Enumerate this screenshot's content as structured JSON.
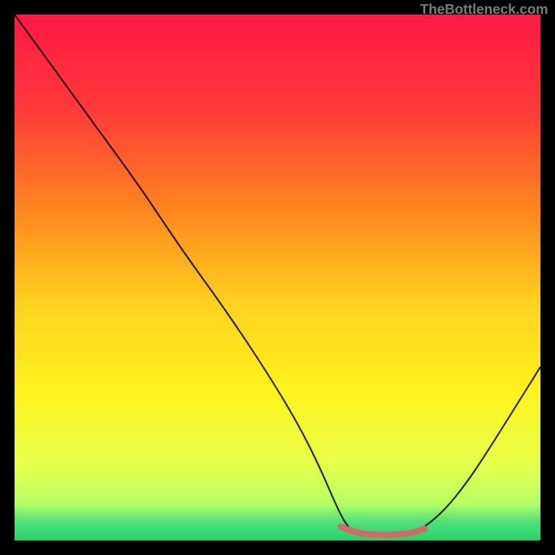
{
  "watermark": "TheBottleneck.com",
  "chart_data": {
    "type": "line",
    "title": "",
    "xlabel": "",
    "ylabel": "",
    "xlim": [
      0,
      100
    ],
    "ylim": [
      0,
      100
    ],
    "gradient_stops": [
      {
        "pos": 0.0,
        "color": "#ff1a47"
      },
      {
        "pos": 0.18,
        "color": "#ff3a3a"
      },
      {
        "pos": 0.38,
        "color": "#ff8a1f"
      },
      {
        "pos": 0.55,
        "color": "#ffd21f"
      },
      {
        "pos": 0.72,
        "color": "#fff31f"
      },
      {
        "pos": 0.85,
        "color": "#e8ff4a"
      },
      {
        "pos": 0.93,
        "color": "#b7ff66"
      },
      {
        "pos": 0.965,
        "color": "#52e07a"
      },
      {
        "pos": 1.0,
        "color": "#1fd66a"
      }
    ],
    "series": [
      {
        "name": "bottleneck-curve",
        "color": "#000000",
        "width": 2,
        "points": [
          {
            "x": 0,
            "y": 100
          },
          {
            "x": 8,
            "y": 89
          },
          {
            "x": 16,
            "y": 78
          },
          {
            "x": 24,
            "y": 67
          },
          {
            "x": 32,
            "y": 55
          },
          {
            "x": 40,
            "y": 44
          },
          {
            "x": 48,
            "y": 32
          },
          {
            "x": 54,
            "y": 22
          },
          {
            "x": 58,
            "y": 14
          },
          {
            "x": 61,
            "y": 7
          },
          {
            "x": 63,
            "y": 3
          },
          {
            "x": 65,
            "y": 1.2
          },
          {
            "x": 70,
            "y": 1.0
          },
          {
            "x": 75,
            "y": 1.2
          },
          {
            "x": 78,
            "y": 2.5
          },
          {
            "x": 82,
            "y": 6
          },
          {
            "x": 86,
            "y": 11
          },
          {
            "x": 90,
            "y": 17
          },
          {
            "x": 95,
            "y": 25
          },
          {
            "x": 100,
            "y": 33
          }
        ]
      },
      {
        "name": "optimal-band",
        "color": "#d36a6a",
        "width": 9,
        "capped": true,
        "points": [
          {
            "x": 62,
            "y": 2.6
          },
          {
            "x": 65,
            "y": 1.4
          },
          {
            "x": 68,
            "y": 1.1
          },
          {
            "x": 72,
            "y": 1.05
          },
          {
            "x": 75,
            "y": 1.3
          },
          {
            "x": 78,
            "y": 2.2
          }
        ]
      }
    ]
  }
}
